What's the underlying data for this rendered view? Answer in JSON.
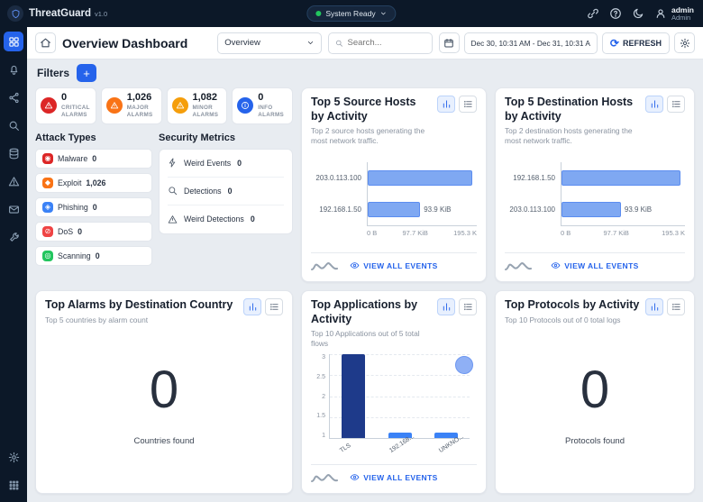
{
  "theme": {
    "accent": "#2563eb",
    "topbar_bg": "#0c1828",
    "page_bg": "#e8ecf1",
    "bar_fill": "#7fa8f2",
    "bar_dark": "#1e3a8a",
    "status_green": "#22c55e"
  },
  "topbar": {
    "app_name": "ThreatGuard",
    "version": "v1.0",
    "system_status": "System Ready",
    "user_name": "admin",
    "user_role": "Admin"
  },
  "sidebar": {
    "items": [
      "dashboard",
      "alerts",
      "share",
      "search",
      "data-sources",
      "alarms",
      "messages",
      "tools"
    ],
    "bottom_items": [
      "settings",
      "apps"
    ]
  },
  "header": {
    "title": "Overview Dashboard",
    "view_select_value": "Overview",
    "search_placeholder": "Search...",
    "date_range": "Dec 30, 10:31 AM - Dec 31, 10:31 A",
    "refresh_label": "REFRESH"
  },
  "filters_label": "Filters",
  "alarm_summary": [
    {
      "value": "0",
      "label": "CRITICAL ALARMS",
      "color": "#dc2626",
      "icon": "alert-triangle-icon"
    },
    {
      "value": "1,026",
      "label": "MAJOR ALARMS",
      "color": "#f97316",
      "icon": "alert-triangle-icon"
    },
    {
      "value": "1,082",
      "label": "MINOR ALARMS",
      "color": "#f59e0b",
      "icon": "alert-triangle-icon"
    },
    {
      "value": "0",
      "label": "INFO ALARMS",
      "color": "#2563eb",
      "icon": "info-circle-icon"
    }
  ],
  "attack_types": {
    "title": "Attack Types",
    "items": [
      {
        "label": "Malware",
        "value": "0",
        "color": "#dc2626",
        "icon": "malware-icon",
        "glyph": "◉"
      },
      {
        "label": "Exploit",
        "value": "1,026",
        "color": "#f97316",
        "icon": "exploit-icon",
        "glyph": "◆"
      },
      {
        "label": "Phishing",
        "value": "0",
        "color": "#3b82f6",
        "icon": "phishing-icon",
        "glyph": "◈"
      },
      {
        "label": "DoS",
        "value": "0",
        "color": "#ef4444",
        "icon": "dos-icon",
        "glyph": "⊘"
      },
      {
        "label": "Scanning",
        "value": "0",
        "color": "#22c55e",
        "icon": "scanning-icon",
        "glyph": "◎"
      }
    ]
  },
  "security_metrics": {
    "title": "Security Metrics",
    "items": [
      {
        "label": "Weird Events",
        "value": "0",
        "icon": "lightning-icon"
      },
      {
        "label": "Detections",
        "value": "0",
        "icon": "search-icon"
      },
      {
        "label": "Weird Detections",
        "value": "0",
        "icon": "alert-triangle-icon"
      }
    ]
  },
  "chart_data": [
    {
      "id": "source_hosts",
      "type": "bar",
      "orientation": "horizontal",
      "title": "Top 5 Source Hosts by Activity",
      "subtitle": "Top 2 source hosts generating the most network traffic.",
      "categories": [
        "203.0.113.100",
        "192.168.1.50"
      ],
      "values_kib": [
        187.8,
        93.9
      ],
      "value_labels": [
        "",
        "93.9 KiB"
      ],
      "x_ticks": [
        "0 B",
        "97.7 KiB",
        "195.3 K"
      ],
      "xlim_kib": [
        0,
        195.3
      ],
      "footer_link": "VIEW ALL EVENTS"
    },
    {
      "id": "destination_hosts",
      "type": "bar",
      "orientation": "horizontal",
      "title": "Top 5 Destination Hosts by Activity",
      "subtitle": "Top 2 destination hosts generating the most network traffic.",
      "categories": [
        "192.168.1.50",
        "203.0.113.100"
      ],
      "values_kib": [
        187.8,
        93.9
      ],
      "value_labels": [
        "",
        "93.9 KiB"
      ],
      "x_ticks": [
        "0 B",
        "97.7 KiB",
        "195.3 K"
      ],
      "xlim_kib": [
        0,
        195.3
      ],
      "footer_link": "VIEW ALL EVENTS"
    },
    {
      "id": "alarms_by_country",
      "type": "big-number",
      "title": "Top Alarms by Destination Country",
      "subtitle": "Top 5 countries by alarm count",
      "value": "0",
      "caption": "Countries found"
    },
    {
      "id": "applications",
      "type": "bar",
      "orientation": "vertical",
      "title": "Top Applications by Activity",
      "subtitle": "Top 10 Applications out of 5 total flows",
      "categories": [
        "TLS",
        "192.168...",
        "UNKNO..."
      ],
      "values": [
        3,
        1,
        1
      ],
      "y_ticks": [
        "3",
        "2.5",
        "2",
        "1.5",
        "1"
      ],
      "ylim": [
        1,
        3
      ],
      "bubble": {
        "category_index": 2,
        "value": 3
      },
      "footer_link": "VIEW ALL EVENTS"
    },
    {
      "id": "protocols",
      "type": "big-number",
      "title": "Top Protocols by Activity",
      "subtitle": "Top 10 Protocols out of 0 total logs",
      "value": "0",
      "caption": "Protocols found"
    }
  ]
}
